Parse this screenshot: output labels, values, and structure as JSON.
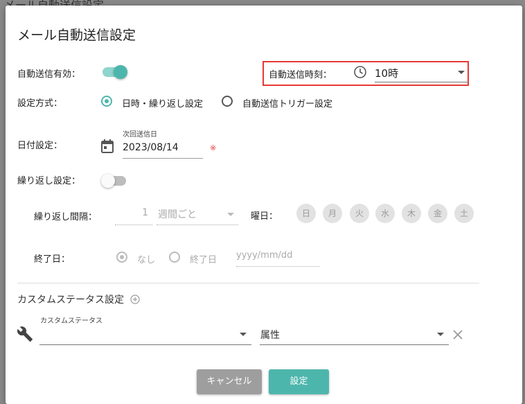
{
  "background": {
    "title": "メール自動送信設定"
  },
  "dialog": {
    "title": "メール自動送信設定",
    "auto_send": {
      "label": "自動送信有効：",
      "enabled": true
    },
    "send_time": {
      "label": "自動送信時刻：",
      "value": "10時",
      "icon": "clock-icon"
    },
    "method": {
      "label": "設定方式：",
      "options": [
        "日時・繰り返し設定",
        "自動送信トリガー設定"
      ],
      "selected": 0
    },
    "date": {
      "label": "日付設定：",
      "field_label": "次回送信日",
      "value": "2023/08/14",
      "required_mark": "※",
      "icon": "calendar-icon"
    },
    "repeat": {
      "label": "繰り返し設定：",
      "enabled": false
    },
    "interval": {
      "label": "繰り返し間隔：",
      "count": "1",
      "unit": "週間ごと"
    },
    "weekday": {
      "label": "曜日：",
      "days": [
        "日",
        "月",
        "火",
        "水",
        "木",
        "金",
        "土"
      ]
    },
    "end_date": {
      "label": "終了日：",
      "options": [
        "なし",
        "終了日"
      ],
      "selected": 0,
      "placeholder": "yyyy/mm/dd"
    },
    "custom_status": {
      "section_label": "カスタムステータス設定",
      "field_label": "カスタムステータス",
      "attr_label": "属性",
      "icon": "wrench-icon"
    },
    "buttons": {
      "cancel": "キャンセル",
      "submit": "設定"
    },
    "colors": {
      "accent": "#4db6ac",
      "highlight": "#e53935",
      "cancel": "#9e9e9e"
    }
  }
}
